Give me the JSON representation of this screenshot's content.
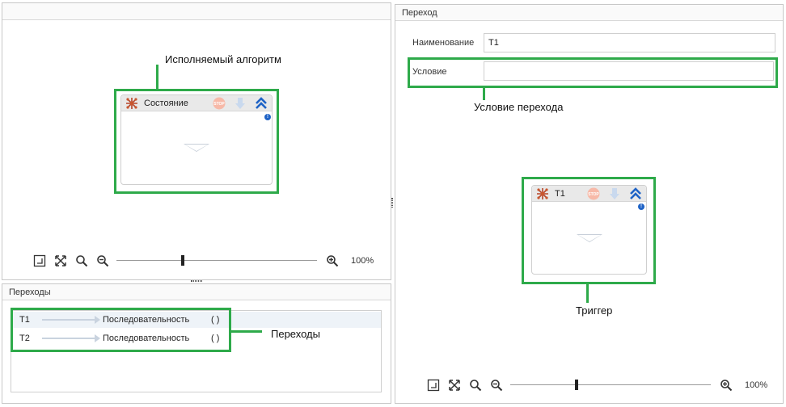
{
  "left_panel": {
    "annotation_algorithm": "Исполняемый алгоритм",
    "node_title": "Состояние",
    "zoom_value": "100%",
    "zoom_level": 0.33
  },
  "transitions_panel": {
    "header": "Переходы",
    "annotation": "Переходы",
    "rows": [
      {
        "name": "T1",
        "type": "Последовательность",
        "params": "( )"
      },
      {
        "name": "T2",
        "type": "Последовательность",
        "params": "( )"
      }
    ]
  },
  "right_panel": {
    "header": "Переход",
    "name_label": "Наименование",
    "name_value": "T1",
    "condition_label": "Условие",
    "condition_value": "",
    "annotation_condition": "Условие перехода",
    "node_title": "T1",
    "annotation_trigger": "Триггер",
    "zoom_value": "100%",
    "zoom_level": 0.33
  },
  "colors": {
    "highlight": "#2eaa4a",
    "accent_blue": "#1f63c6",
    "stop_red": "#f26c4f"
  },
  "icons": [
    "algorithm-icon",
    "stop-icon",
    "arrow-down-icon",
    "double-chevron-up-icon",
    "info-icon",
    "fit-page-icon",
    "expand-icon",
    "search-icon",
    "zoom-out-icon",
    "zoom-in-icon"
  ]
}
